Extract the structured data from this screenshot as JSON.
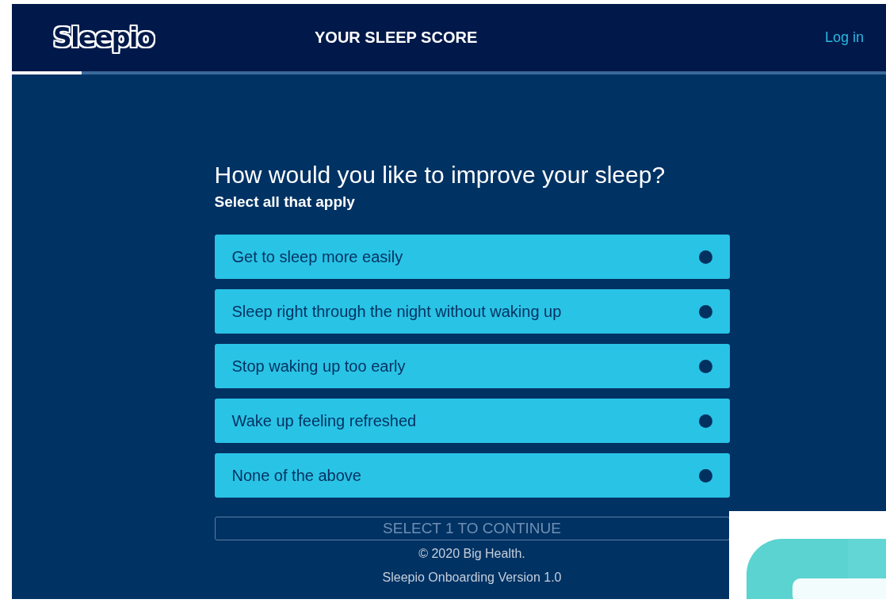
{
  "header": {
    "logo": "Sleepio",
    "title": "YOUR SLEEP SCORE",
    "login": "Log in"
  },
  "progress": {
    "level": 0.08
  },
  "question": {
    "title": "How would you like to improve your sleep?",
    "subtitle": "Select all that apply"
  },
  "options": [
    {
      "label": "Get to sleep more easily",
      "selected": false
    },
    {
      "label": "Sleep right through the night without waking up",
      "selected": false
    },
    {
      "label": "Stop waking up too early",
      "selected": false
    },
    {
      "label": "Wake up feeling refreshed",
      "selected": false
    },
    {
      "label": "None of the above",
      "selected": false
    }
  ],
  "continue_button": {
    "label": "SELECT 1 TO CONTINUE",
    "disabled": true
  },
  "footer": {
    "copyright": "© 2020 Big Health.",
    "version": "Sleepio Onboarding Version 1.0"
  }
}
